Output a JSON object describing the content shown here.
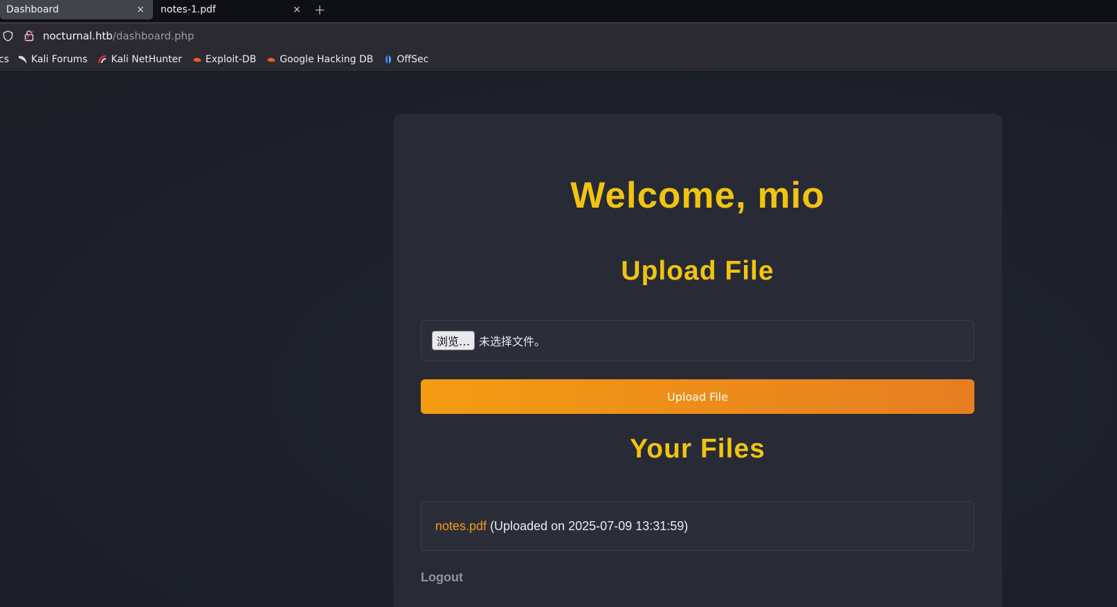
{
  "browser": {
    "tabs": [
      {
        "title": "Dashboard",
        "active": true
      },
      {
        "title": "notes-1.pdf",
        "active": false
      }
    ],
    "new_tab_label": "+",
    "close_glyph": "×",
    "url": {
      "host": "nocturnal.htb",
      "path": "/dashboard.php"
    },
    "bookmarks": [
      {
        "label": "cs",
        "icon": "truncated-bookmark"
      },
      {
        "label": "Kali Forums",
        "icon": "kali-dragon-icon"
      },
      {
        "label": "Kali NetHunter",
        "icon": "nethunter-icon"
      },
      {
        "label": "Exploit-DB",
        "icon": "exploit-db-icon"
      },
      {
        "label": "Google Hacking DB",
        "icon": "ghdb-icon"
      },
      {
        "label": "OffSec",
        "icon": "offsec-icon"
      }
    ]
  },
  "page": {
    "welcome": "Welcome, mio",
    "upload_heading": "Upload File",
    "browse_button": "浏览…",
    "no_file_text": "未选择文件。",
    "upload_button": "Upload File",
    "files_heading": "Your Files",
    "files": [
      {
        "name": "notes.pdf",
        "meta": "(Uploaded on 2025-07-09 13:31:59)"
      }
    ],
    "logout": "Logout"
  },
  "colors": {
    "accent_yellow": "#f1c40f",
    "button_orange_start": "#f39c12",
    "button_orange_end": "#e67e22",
    "card_bg": "#282a35",
    "page_bg": "#1c1f27"
  }
}
